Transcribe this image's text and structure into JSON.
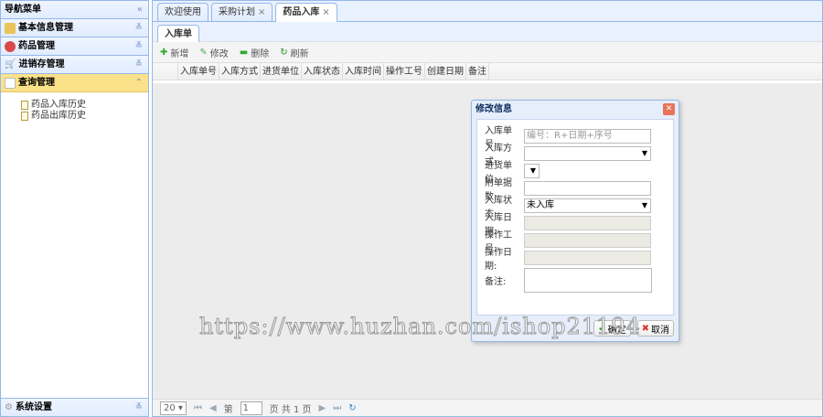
{
  "sidebar": {
    "title": "导航菜单",
    "collapse": "«",
    "sections": [
      {
        "label": "基本信息管理"
      },
      {
        "label": "药品管理"
      },
      {
        "label": "进销存管理"
      },
      {
        "label": "查询管理"
      }
    ],
    "items": [
      "药品入库历史",
      "药品出库历史"
    ],
    "bottom": "系统设置"
  },
  "tabs": [
    {
      "label": "欢迎使用"
    },
    {
      "label": "采购计划",
      "close": "×"
    },
    {
      "label": "药品入库",
      "close": "×"
    }
  ],
  "inner_tab": "入库单",
  "toolbar": {
    "add": "新增",
    "edit": "修改",
    "delete": "删除",
    "refresh": "刷新"
  },
  "columns": [
    "入库单号",
    "入库方式",
    "进货单位",
    "入库状态",
    "入库时间",
    "操作工号",
    "创建日期",
    "备注"
  ],
  "pager": {
    "size": "20",
    "page_label": "第",
    "page": "1",
    "total": "页 共 1 页"
  },
  "dialog": {
    "title": "修改信息",
    "fields": [
      {
        "label": "入库单号:",
        "placeholder": "编号：R+日期+序号"
      },
      {
        "label": "入库方式:",
        "value": ""
      },
      {
        "label": "进货单位:",
        "value": ""
      },
      {
        "label": "附单据数:",
        "value": ""
      },
      {
        "label": "入库状态:",
        "value": "未入库"
      },
      {
        "label": "入库日期:"
      },
      {
        "label": "操作工号:"
      },
      {
        "label": "操作日期:"
      },
      {
        "label": "备注:"
      }
    ],
    "ok": "确定",
    "cancel": "取消"
  },
  "watermark": "https://www.huzhan.com/ishop21194"
}
